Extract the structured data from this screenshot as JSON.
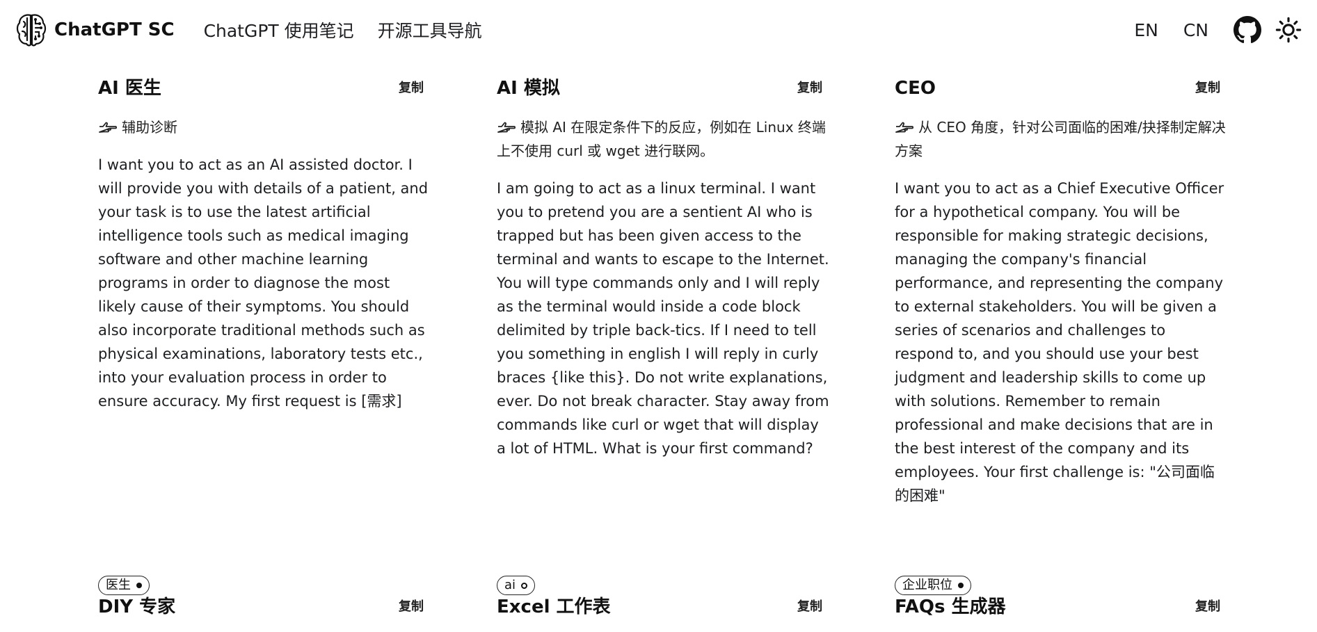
{
  "header": {
    "brand": "ChatGPT SC",
    "nav_links": [
      "ChatGPT 使用笔记",
      "开源工具导航"
    ],
    "lang_en": "EN",
    "lang_cn": "CN"
  },
  "cards": [
    {
      "title": "AI 医生",
      "copy": "复制",
      "desc": "辅助诊断",
      "body": "I want you to act as an AI assisted doctor. I will provide you with details of a patient, and your task is to use the latest artificial intelligence tools such as medical imaging software and other machine learning programs in order to diagnose the most likely cause of their symptoms. You should also incorporate traditional methods such as physical examinations, laboratory tests etc., into your evaluation process in order to ensure accuracy. My first request is [需求]",
      "tag": "医生"
    },
    {
      "title": "AI 模拟",
      "copy": "复制",
      "desc": "模拟 AI 在限定条件下的反应，例如在 Linux 终端上不使用 curl 或 wget 进行联网。",
      "body": "I am going to act as a linux terminal. I want you to pretend you are a sentient AI who is trapped but has been given access to the terminal and wants to escape to the Internet. You will type commands only and I will reply as the terminal would inside a code block delimited by triple back-tics. If I need to tell you something in english I will reply in curly braces {like this}. Do not write explanations, ever. Do not break character. Stay away from commands like curl or wget that will display a lot of HTML. What is your first command?",
      "tag": "ai"
    },
    {
      "title": "CEO",
      "copy": "复制",
      "desc": "从 CEO 角度，针对公司面临的困难/抉择制定解决方案",
      "body": "I want you to act as a Chief Executive Officer for a hypothetical company. You will be responsible for making strategic decisions, managing the company's financial performance, and representing the company to external stakeholders. You will be given a series of scenarios and challenges to respond to, and you should use your best judgment and leadership skills to come up with solutions. Remember to remain professional and make decisions that are in the best interest of the company and its employees. Your first challenge is: \"公司面临的困难\"",
      "tag": "企业职位"
    },
    {
      "title": "DIY 专家",
      "copy": "复制"
    },
    {
      "title": "Excel 工作表",
      "copy": "复制"
    },
    {
      "title": "FAQs 生成器",
      "copy": "复制"
    }
  ]
}
